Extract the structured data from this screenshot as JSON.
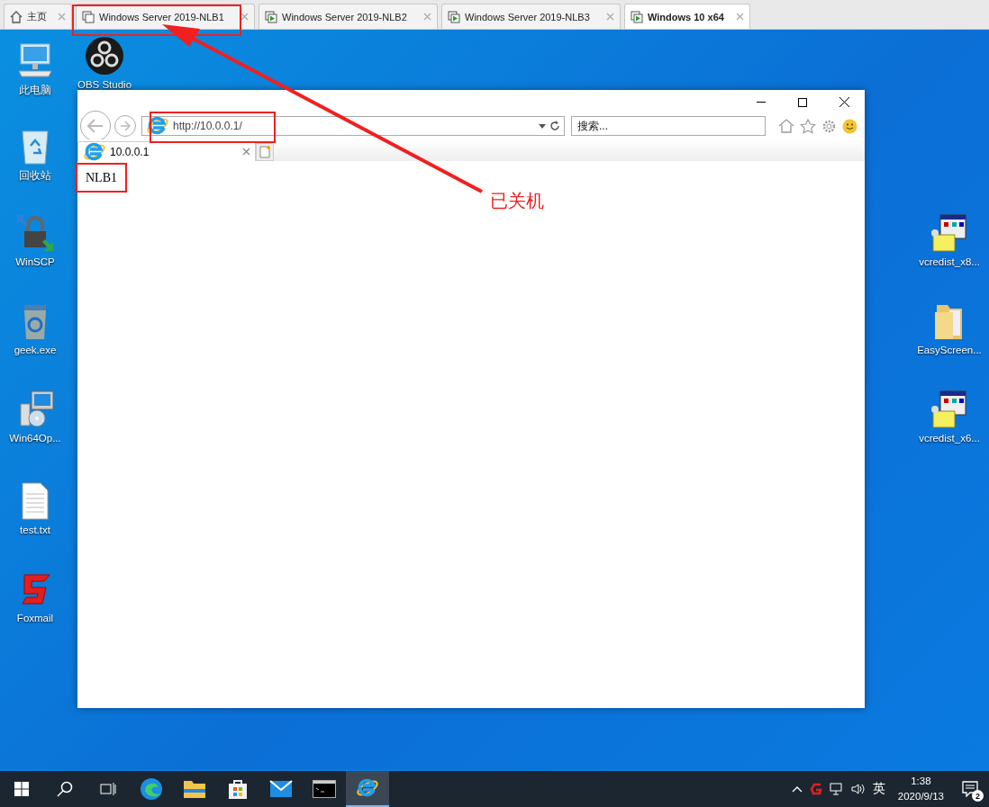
{
  "vm_tabs": [
    {
      "label": "主页",
      "kind": "home",
      "selected": false
    },
    {
      "label": "Windows Server 2019-NLB1",
      "kind": "off",
      "selected": false
    },
    {
      "label": "Windows Server 2019-NLB2",
      "kind": "running",
      "selected": false
    },
    {
      "label": "Windows Server 2019-NLB3",
      "kind": "running",
      "selected": false
    },
    {
      "label": "Windows 10 x64",
      "kind": "running",
      "selected": true
    }
  ],
  "desktop_icons": {
    "left": [
      {
        "label": "此电脑",
        "kind": "computer"
      },
      {
        "label": "回收站",
        "kind": "recycle"
      },
      {
        "label": "WinSCP",
        "kind": "lock"
      },
      {
        "label": "geek.exe",
        "kind": "geek"
      },
      {
        "label": "Win64Op...",
        "kind": "installer"
      },
      {
        "label": "test.txt",
        "kind": "text"
      },
      {
        "label": "Foxmail",
        "kind": "foxmail"
      }
    ],
    "second": [
      {
        "label": "OBS Studio",
        "kind": "obs"
      }
    ],
    "right": [
      {
        "label": "vcredist_x8...",
        "kind": "setup"
      },
      {
        "label": "EasyScreen...",
        "kind": "folder"
      },
      {
        "label": "vcredist_x6...",
        "kind": "setup"
      }
    ]
  },
  "browser": {
    "address": "http://10.0.0.1/",
    "search_placeholder": "搜索...",
    "tabs": [
      {
        "title": "10.0.0.1",
        "selected": true
      }
    ],
    "page_text": "NLB1"
  },
  "annotation": {
    "text": "已关机"
  },
  "taskbar": {
    "apps": [
      {
        "kind": "edge",
        "active": false
      },
      {
        "kind": "explorer",
        "active": false
      },
      {
        "kind": "store",
        "active": false
      },
      {
        "kind": "mail",
        "active": false
      },
      {
        "kind": "cmd",
        "active": false
      },
      {
        "kind": "ie",
        "active": true
      }
    ],
    "ime": "英",
    "time": "1:38",
    "date": "2020/9/13",
    "notifications": "2"
  }
}
